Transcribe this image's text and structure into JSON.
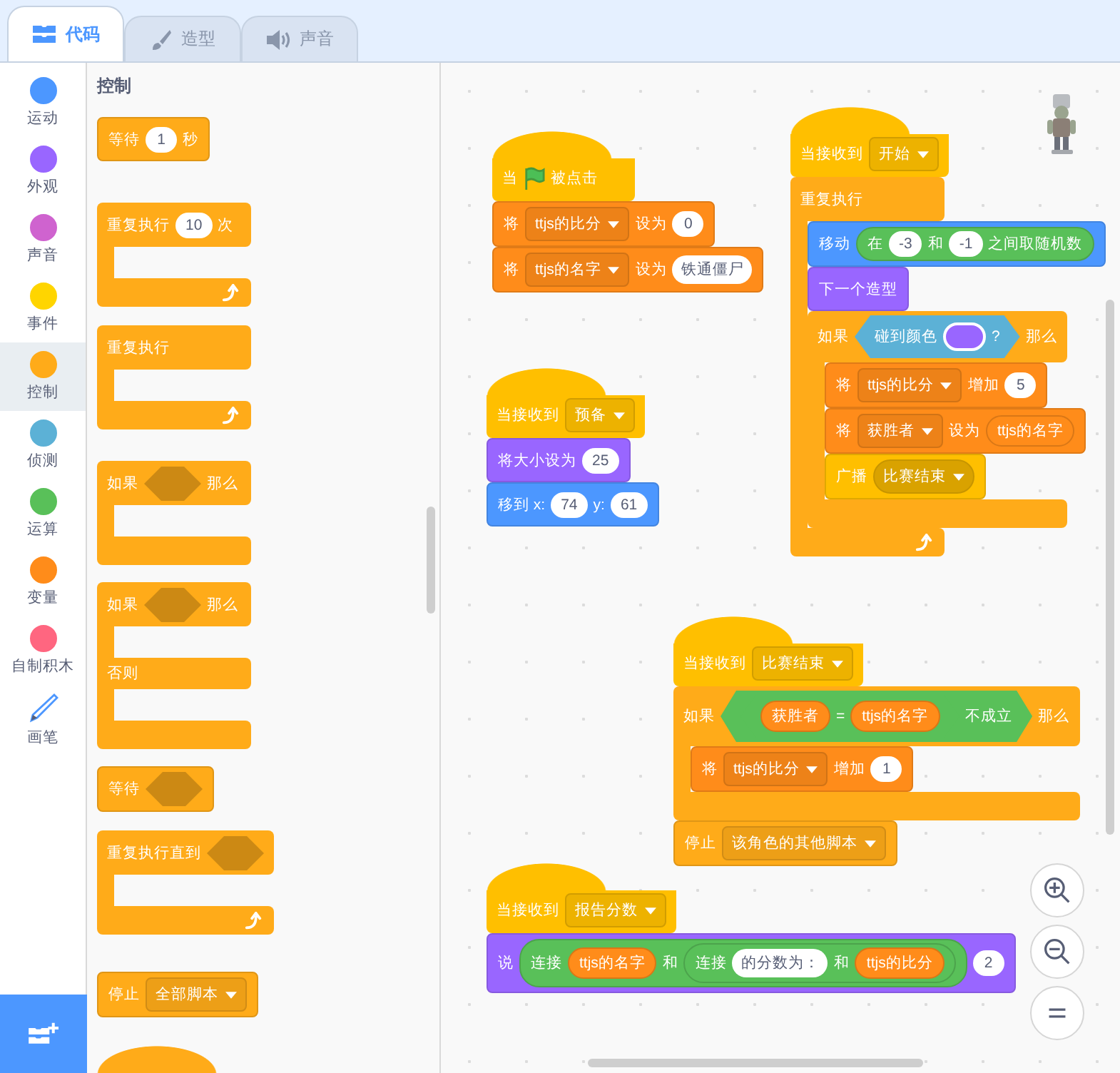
{
  "tabs": [
    {
      "label": "代码",
      "kind": "code",
      "selected": true
    },
    {
      "label": "造型",
      "kind": "costume",
      "selected": false
    },
    {
      "label": "声音",
      "kind": "sound",
      "selected": false
    }
  ],
  "categories": [
    {
      "label": "运动",
      "kind": "dot",
      "color": "#4c97ff",
      "selected": false
    },
    {
      "label": "外观",
      "kind": "dot",
      "color": "#9966ff",
      "selected": false
    },
    {
      "label": "声音",
      "kind": "dot",
      "color": "#cf63cf",
      "selected": false
    },
    {
      "label": "事件",
      "kind": "dot",
      "color": "#ffd500",
      "selected": false
    },
    {
      "label": "控制",
      "kind": "dot",
      "color": "#ffab19",
      "selected": true
    },
    {
      "label": "侦测",
      "kind": "dot",
      "color": "#5cb1d6",
      "selected": false
    },
    {
      "label": "运算",
      "kind": "dot",
      "color": "#59c059",
      "selected": false
    },
    {
      "label": "变量",
      "kind": "dot",
      "color": "#ff8c1a",
      "selected": false
    },
    {
      "label": "自制积木",
      "kind": "dot",
      "color": "#ff6680",
      "selected": false
    },
    {
      "label": "画笔",
      "kind": "pen",
      "selected": false
    }
  ],
  "palette": {
    "title": "控制",
    "blocks": [
      {
        "kind": "stack",
        "color": "#ffab19",
        "parts": [
          {
            "kind": "text",
            "text": "等待"
          },
          {
            "kind": "num",
            "text": "1"
          },
          {
            "kind": "text",
            "text": "秒"
          }
        ]
      },
      {
        "kind": "c",
        "color": "#ffab19",
        "loop": true,
        "parts": [
          {
            "kind": "text",
            "text": "重复执行"
          },
          {
            "kind": "num",
            "text": "10"
          },
          {
            "kind": "text",
            "text": "次"
          }
        ]
      },
      {
        "kind": "c",
        "color": "#ffab19",
        "loop": true,
        "parts": [
          {
            "kind": "text",
            "text": "重复执行"
          }
        ]
      },
      {
        "kind": "c",
        "color": "#ffab19",
        "loop": false,
        "parts": [
          {
            "kind": "text",
            "text": "如果"
          },
          {
            "kind": "slot"
          },
          {
            "kind": "text",
            "text": "那么"
          }
        ]
      },
      {
        "kind": "c_else",
        "color": "#ffab19",
        "loop": false,
        "parts": [
          {
            "kind": "text",
            "text": "如果"
          },
          {
            "kind": "slot"
          },
          {
            "kind": "text",
            "text": "那么"
          }
        ],
        "else_parts": [
          {
            "kind": "text",
            "text": "否则"
          }
        ]
      },
      {
        "kind": "stack",
        "color": "#ffab19",
        "parts": [
          {
            "kind": "text",
            "text": "等待"
          },
          {
            "kind": "slot"
          }
        ]
      },
      {
        "kind": "c",
        "color": "#ffab19",
        "loop": true,
        "parts": [
          {
            "kind": "text",
            "text": "重复执行直到"
          },
          {
            "kind": "slot"
          }
        ]
      },
      {
        "kind": "stack",
        "color": "#ffab19",
        "parts": [
          {
            "kind": "text",
            "text": "停止"
          },
          {
            "kind": "menu",
            "text": "全部脚本"
          }
        ]
      },
      {
        "kind": "hat",
        "color": "#ffab19"
      }
    ]
  },
  "scripts": [
    {
      "blocks": [
        {
          "kind": "hat",
          "color": "#ffbf00",
          "parts": [
            {
              "kind": "text",
              "text": "当"
            },
            {
              "kind": "flag"
            },
            {
              "kind": "text",
              "text": "被点击"
            }
          ]
        },
        {
          "kind": "stack",
          "color": "#ff8c1a",
          "parts": [
            {
              "kind": "text",
              "text": "将"
            },
            {
              "kind": "menu",
              "text": "ttjs的比分"
            },
            {
              "kind": "text",
              "text": "设为"
            },
            {
              "kind": "num",
              "text": "0"
            }
          ]
        },
        {
          "kind": "stack",
          "color": "#ff8c1a",
          "parts": [
            {
              "kind": "text",
              "text": "将"
            },
            {
              "kind": "menu",
              "text": "ttjs的名字"
            },
            {
              "kind": "text",
              "text": "设为"
            },
            {
              "kind": "textin",
              "text": "铁通僵尸"
            }
          ]
        }
      ]
    },
    {
      "blocks": [
        {
          "kind": "hat",
          "color": "#ffbf00",
          "parts": [
            {
              "kind": "text",
              "text": "当接收到"
            },
            {
              "kind": "menu",
              "text": "预备"
            }
          ]
        },
        {
          "kind": "stack",
          "color": "#9966ff",
          "parts": [
            {
              "kind": "text",
              "text": "将大小设为"
            },
            {
              "kind": "num",
              "text": "25"
            }
          ]
        },
        {
          "kind": "stack",
          "color": "#4c97ff",
          "parts": [
            {
              "kind": "text",
              "text": "移到 x:"
            },
            {
              "kind": "num",
              "text": "74"
            },
            {
              "kind": "text",
              "text": "y:"
            },
            {
              "kind": "num",
              "text": "61"
            }
          ]
        }
      ]
    },
    {
      "blocks": [
        {
          "kind": "hat",
          "color": "#ffbf00",
          "parts": [
            {
              "kind": "text",
              "text": "当接收到"
            },
            {
              "kind": "menu",
              "text": "开始"
            }
          ]
        },
        {
          "kind": "c",
          "color": "#ffab19",
          "loop": true,
          "parts": [
            {
              "kind": "text",
              "text": "重复执行"
            }
          ],
          "inner": [
            {
              "kind": "stack",
              "color": "#4c97ff",
              "parts": [
                {
                  "kind": "text",
                  "text": "移动"
                },
                {
                  "kind": "op",
                  "color": "#59c059",
                  "parts": [
                    {
                      "kind": "text",
                      "text": "在"
                    },
                    {
                      "kind": "num",
                      "text": "-3"
                    },
                    {
                      "kind": "text",
                      "text": "和"
                    },
                    {
                      "kind": "num",
                      "text": "-1"
                    },
                    {
                      "kind": "text",
                      "text": "之间取随机数"
                    }
                  ]
                }
              ]
            },
            {
              "kind": "stack",
              "color": "#9966ff",
              "parts": [
                {
                  "kind": "text",
                  "text": "下一个造型"
                }
              ]
            },
            {
              "kind": "c",
              "color": "#ffab19",
              "loop": false,
              "parts": [
                {
                  "kind": "text",
                  "text": "如果"
                },
                {
                  "kind": "bool",
                  "color": "#5cb1d6",
                  "parts": [
                    {
                      "kind": "text",
                      "text": "碰到颜色"
                    },
                    {
                      "kind": "swatch",
                      "color": "#9966ff"
                    },
                    {
                      "kind": "text",
                      "text": "?"
                    }
                  ]
                },
                {
                  "kind": "text",
                  "text": "那么"
                }
              ],
              "inner": [
                {
                  "kind": "stack",
                  "color": "#ff8c1a",
                  "parts": [
                    {
                      "kind": "text",
                      "text": "将"
                    },
                    {
                      "kind": "menu",
                      "text": "ttjs的比分"
                    },
                    {
                      "kind": "text",
                      "text": "增加"
                    },
                    {
                      "kind": "num",
                      "text": "5"
                    }
                  ]
                },
                {
                  "kind": "stack",
                  "color": "#ff8c1a",
                  "parts": [
                    {
                      "kind": "text",
                      "text": "将"
                    },
                    {
                      "kind": "menu",
                      "text": "获胜者"
                    },
                    {
                      "kind": "text",
                      "text": "设为"
                    },
                    {
                      "kind": "reporter",
                      "color": "#ff8c1a",
                      "text": "ttjs的名字"
                    }
                  ]
                },
                {
                  "kind": "stack",
                  "color": "#ffbf00",
                  "parts": [
                    {
                      "kind": "text",
                      "text": "广播"
                    },
                    {
                      "kind": "pill_menu",
                      "text": "比赛结束"
                    }
                  ]
                }
              ]
            }
          ]
        }
      ]
    },
    {
      "blocks": [
        {
          "kind": "hat",
          "color": "#ffbf00",
          "parts": [
            {
              "kind": "text",
              "text": "当接收到"
            },
            {
              "kind": "menu",
              "text": "比赛结束"
            }
          ]
        },
        {
          "kind": "c",
          "color": "#ffab19",
          "loop": false,
          "parts": [
            {
              "kind": "text",
              "text": "如果"
            },
            {
              "kind": "bool",
              "color": "#59c059",
              "parts": [
                {
                  "kind": "bool",
                  "color": "#59c059",
                  "parts": [
                    {
                      "kind": "reporter",
                      "color": "#ff8c1a",
                      "text": "获胜者"
                    },
                    {
                      "kind": "text",
                      "text": "="
                    },
                    {
                      "kind": "reporter",
                      "color": "#ff8c1a",
                      "text": "ttjs的名字"
                    }
                  ]
                },
                {
                  "kind": "text",
                  "text": "不成立"
                }
              ]
            },
            {
              "kind": "text",
              "text": "那么"
            }
          ],
          "inner": [
            {
              "kind": "stack",
              "color": "#ff8c1a",
              "parts": [
                {
                  "kind": "text",
                  "text": "将"
                },
                {
                  "kind": "menu",
                  "text": "ttjs的比分"
                },
                {
                  "kind": "text",
                  "text": "增加"
                },
                {
                  "kind": "num",
                  "text": "1"
                }
              ]
            }
          ]
        },
        {
          "kind": "stack",
          "color": "#ffab19",
          "parts": [
            {
              "kind": "text",
              "text": "停止"
            },
            {
              "kind": "menu",
              "text": "该角色的其他脚本"
            }
          ]
        }
      ]
    },
    {
      "blocks": [
        {
          "kind": "hat",
          "color": "#ffbf00",
          "parts": [
            {
              "kind": "text",
              "text": "当接收到"
            },
            {
              "kind": "menu",
              "text": "报告分数"
            }
          ]
        },
        {
          "kind": "stack",
          "color": "#9966ff",
          "parts": [
            {
              "kind": "text",
              "text": "说"
            },
            {
              "kind": "op",
              "color": "#59c059",
              "parts": [
                {
                  "kind": "text",
                  "text": "连接"
                },
                {
                  "kind": "reporter",
                  "color": "#ff8c1a",
                  "text": "ttjs的名字"
                },
                {
                  "kind": "text",
                  "text": "和"
                },
                {
                  "kind": "op",
                  "color": "#59c059",
                  "parts": [
                    {
                      "kind": "text",
                      "text": "连接"
                    },
                    {
                      "kind": "textin",
                      "text": "的分数为："
                    },
                    {
                      "kind": "text",
                      "text": "和"
                    },
                    {
                      "kind": "reporter",
                      "color": "#ff8c1a",
                      "text": "ttjs的比分"
                    }
                  ]
                }
              ]
            },
            {
              "kind": "num",
              "text": "2"
            }
          ]
        }
      ]
    }
  ]
}
